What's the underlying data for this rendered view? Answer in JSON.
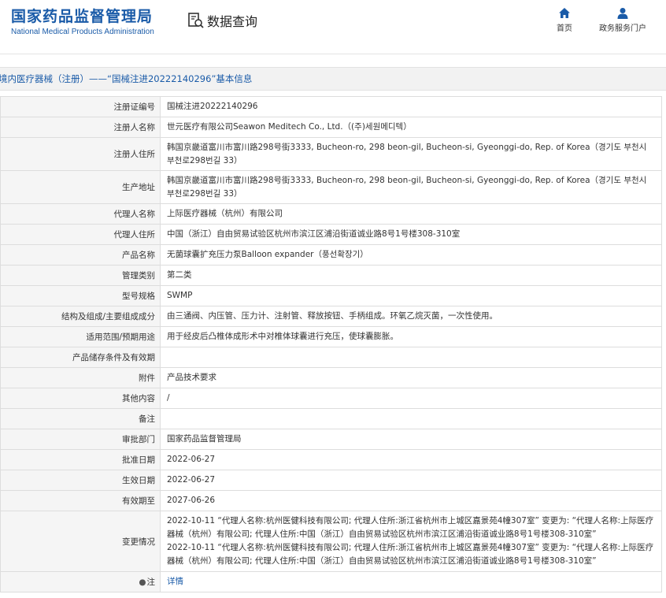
{
  "header": {
    "logo_cn": "国家药品监督管理局",
    "logo_en": "National Medical Products Administration",
    "search_title": "数据查询",
    "nav": [
      {
        "label": "首页",
        "icon": "home-icon"
      },
      {
        "label": "政务服务门户",
        "icon": "user-icon"
      }
    ]
  },
  "page_title": "境内医疗器械（注册）——“国械注进20222140296”基本信息",
  "rows": [
    {
      "key": "注册证编号",
      "value": "国械注进20222140296"
    },
    {
      "key": "注册人名称",
      "value": "世元医疗有限公司Seawon Meditech Co., Ltd.（(주)세원메디텍）"
    },
    {
      "key": "注册人住所",
      "value": "韩国京畿道富川市富川路298号街3333, Bucheon-ro, 298 beon-gil, Bucheon-si, Gyeonggi-do, Rep. of Korea（경기도 부천시 부천로298번길 33）"
    },
    {
      "key": "生产地址",
      "value": "韩国京畿道富川市富川路298号街3333, Bucheon-ro, 298 beon-gil, Bucheon-si, Gyeonggi-do, Rep. of Korea（경기도 부천시 부천로298번길 33）"
    },
    {
      "key": "代理人名称",
      "value": "上际医疗器械（杭州）有限公司"
    },
    {
      "key": "代理人住所",
      "value": "中国（浙江）自由贸易试验区杭州市滨江区浦沿街道诚业路8号1号楼308-310室"
    },
    {
      "key": "产品名称",
      "value": "无菌球囊扩充压力泵Balloon expander（풍선확장기）"
    },
    {
      "key": "管理类别",
      "value": "第二类"
    },
    {
      "key": "型号规格",
      "value": "SWMP"
    },
    {
      "key": "结构及组成/主要组成成分",
      "value": "由三通阀、内压管、压力计、注射管、释放按钮、手柄组成。环氧乙烷灭菌，一次性使用。"
    },
    {
      "key": "适用范围/预期用途",
      "value": "用于经皮后凸椎体成形术中对椎体球囊进行充压，使球囊膨胀。"
    },
    {
      "key": "产品储存条件及有效期",
      "value": ""
    },
    {
      "key": "附件",
      "value": "产品技术要求"
    },
    {
      "key": "其他内容",
      "value": "/"
    },
    {
      "key": "备注",
      "value": ""
    },
    {
      "key": "审批部门",
      "value": "国家药品监督管理局"
    },
    {
      "key": "批准日期",
      "value": "2022-06-27"
    },
    {
      "key": "生效日期",
      "value": "2022-06-27"
    },
    {
      "key": "有效期至",
      "value": "2027-06-26"
    }
  ],
  "changes": {
    "key": "变更情况",
    "lines": [
      "2022-10-11 “代理人名称:杭州医健科技有限公司; 代理人住所:浙江省杭州市上城区嘉景苑4幢307室” 变更为: “代理人名称:上际医疗器械（杭州）有限公司; 代理人住所:中国（浙江）自由贸易试验区杭州市滨江区浦沿街道诚业路8号1号楼308-310室”",
      "2022-10-11 “代理人名称:杭州医健科技有限公司; 代理人住所:浙江省杭州市上城区嘉景苑4幢307室” 变更为: “代理人名称:上际医疗器械（杭州）有限公司; 代理人住所:中国（浙江）自由贸易试验区杭州市滨江区浦沿街道诚业路8号1号楼308-310室”"
    ]
  },
  "note": {
    "key": "注",
    "link": "详情"
  },
  "colors": {
    "brand": "#1a5ba8",
    "header_bg": "#f5f5f5",
    "border": "#dddddd"
  }
}
